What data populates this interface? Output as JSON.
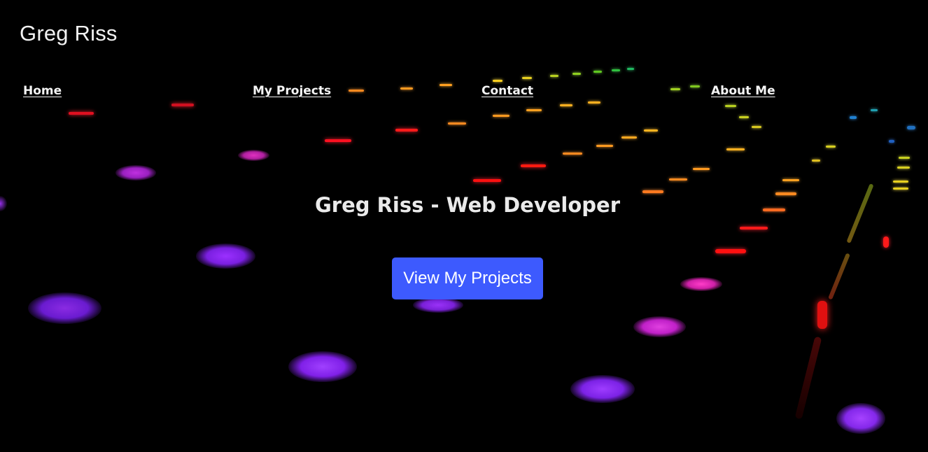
{
  "header": {
    "brand": "Greg Riss"
  },
  "nav": {
    "items": [
      {
        "label": "Home"
      },
      {
        "label": "My Projects"
      },
      {
        "label": "Contact"
      },
      {
        "label": "About Me"
      }
    ]
  },
  "hero": {
    "title": "Greg Riss - Web Developer",
    "cta_label": "View My Projects",
    "background": "dark keyboard with rainbow backlit keys",
    "accent_color": "#3d5afe"
  }
}
